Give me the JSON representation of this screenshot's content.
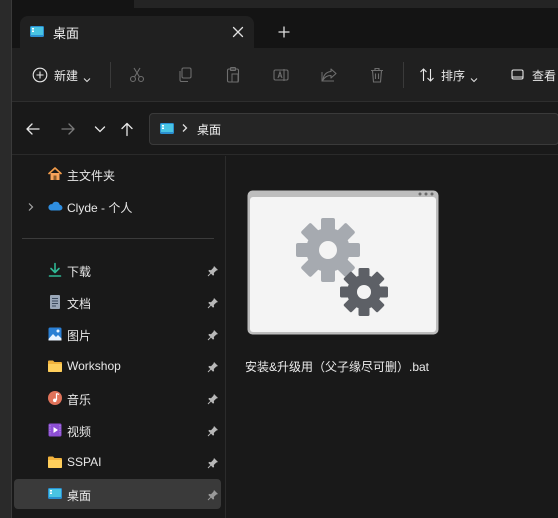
{
  "window": {
    "tab_title": "桌面",
    "icons": {
      "tab": "desktop-folder-icon",
      "close": "close-icon",
      "new_tab": "plus-icon"
    }
  },
  "toolbar": {
    "new_label": "新建",
    "sort_label": "排序",
    "view_label": "查看",
    "icons": [
      "cut-icon",
      "copy-icon",
      "paste-icon",
      "rename-icon",
      "share-icon",
      "delete-icon"
    ]
  },
  "address": {
    "path": [
      "桌面"
    ]
  },
  "sidebar": {
    "home": {
      "label": "主文件夹",
      "icon": "home-icon"
    },
    "onedrive": {
      "label": "Clyde - 个人",
      "icon": "cloud-icon"
    },
    "pinned": [
      {
        "label": "下载",
        "icon": "download-icon"
      },
      {
        "label": "文档",
        "icon": "document-icon"
      },
      {
        "label": "图片",
        "icon": "picture-icon"
      },
      {
        "label": "Workshop",
        "icon": "folder-icon"
      },
      {
        "label": "音乐",
        "icon": "music-icon"
      },
      {
        "label": "视频",
        "icon": "video-icon"
      },
      {
        "label": "SSPAI",
        "icon": "folder-icon"
      },
      {
        "label": "桌面",
        "icon": "desktop-folder-icon",
        "selected": true
      }
    ]
  },
  "files": [
    {
      "name": "安装&升级用（父子缘尽可删）.bat",
      "icon": "batch-file-gears-icon"
    }
  ],
  "colors": {
    "accent_teal": "#4ec3d6",
    "folder_yellow": "#f5c542",
    "selected_bg": "#3a3a3a"
  }
}
